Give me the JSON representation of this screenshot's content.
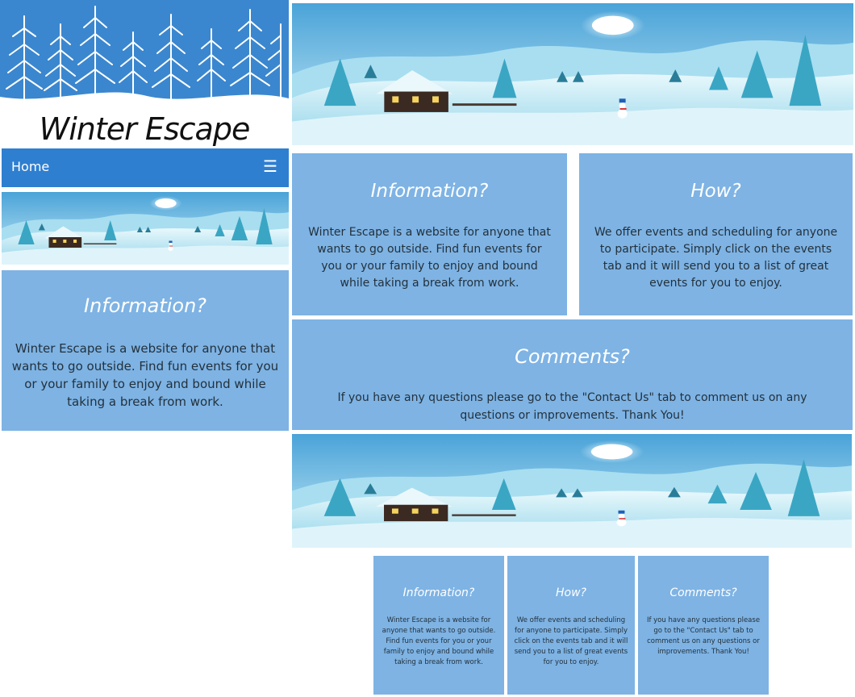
{
  "site": {
    "title": "Winter Escape"
  },
  "nav": {
    "home_label": "Home",
    "menu_icon": "☰",
    "accent_color": "#2f7fd1"
  },
  "sections": {
    "information": {
      "heading": "Information?",
      "body": "Winter Escape is a website for anyone that wants to go outside. Find fun events for you or your family to enjoy and bound while taking a break from work."
    },
    "how": {
      "heading": "How?",
      "body": "We offer events and scheduling for anyone to participate. Simply click on the events tab and it will send you to a list of great events for you to enjoy."
    },
    "comments": {
      "heading": "Comments?",
      "body": "If you have any questions please go to the \"Contact Us\" tab to comment us on any questions or improvements. Thank You!"
    }
  },
  "colors": {
    "panel": "#7eb3e4",
    "header_sky": "#3b87cf"
  },
  "icons": {
    "menu": "hamburger-menu-icon"
  }
}
